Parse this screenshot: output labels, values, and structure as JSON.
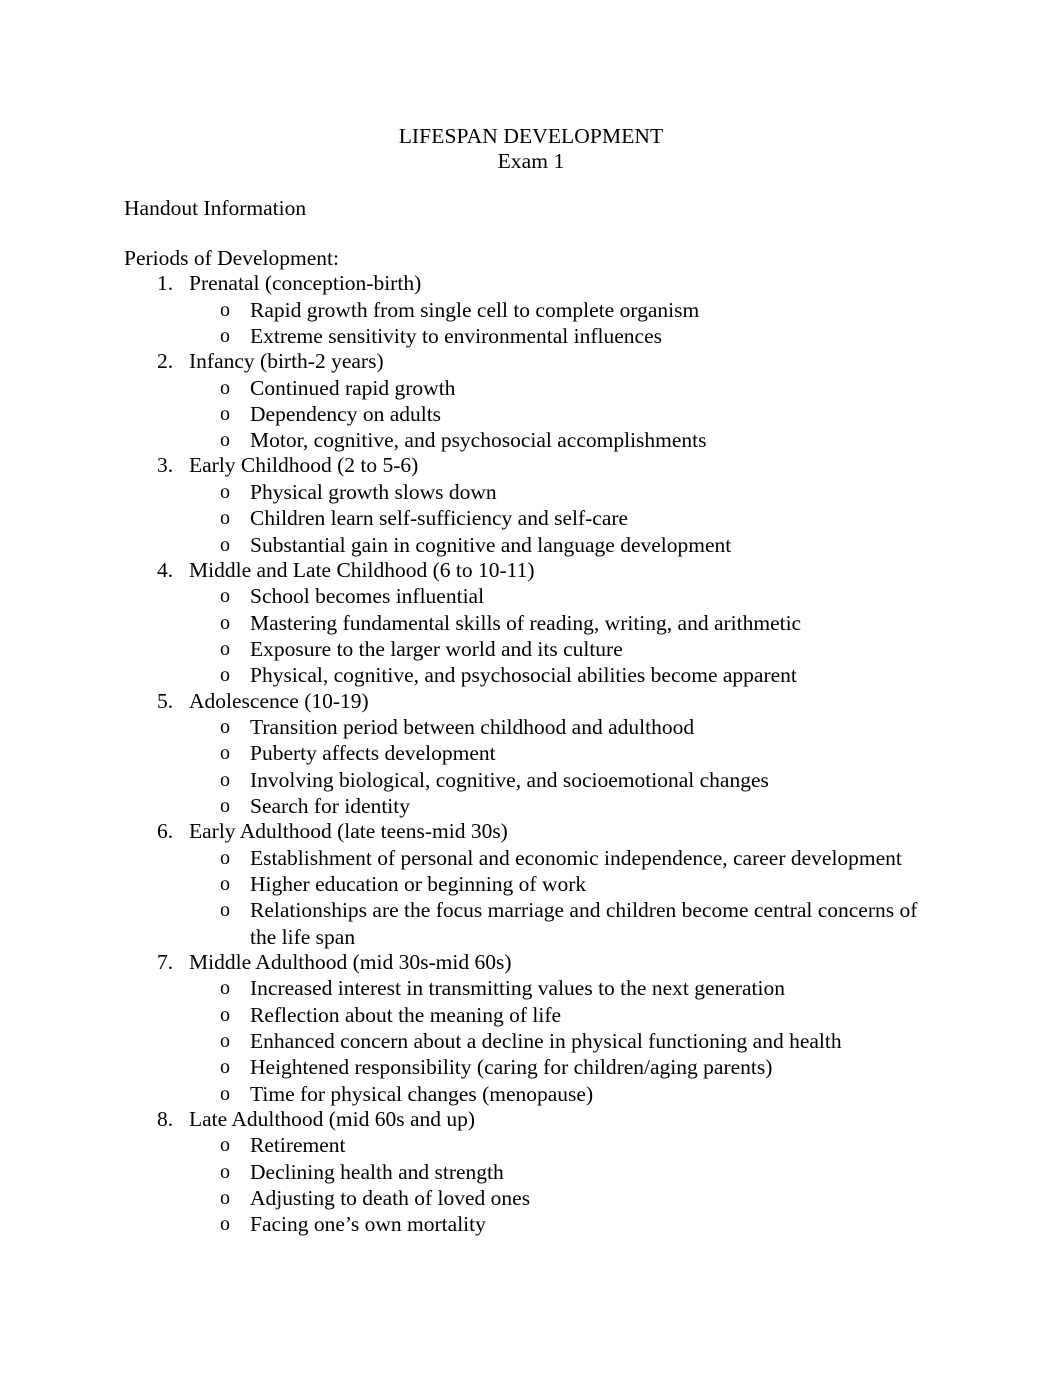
{
  "document": {
    "title": "LIFESPAN DEVELOPMENT",
    "subtitle": "Exam 1",
    "intro": "Handout Information",
    "section_heading": "Periods of Development:",
    "sub_bullet_marker": "o",
    "text_color": "#000000",
    "background_color": "#ffffff"
  },
  "periods": [
    {
      "number": "1.",
      "label": "Prenatal (conception-birth)",
      "points": [
        "Rapid growth from single cell to complete organism",
        "Extreme sensitivity to environmental influences"
      ]
    },
    {
      "number": "2.",
      "label": "Infancy (birth-2 years)",
      "points": [
        "Continued rapid growth",
        "Dependency on adults",
        "Motor, cognitive, and psychosocial accomplishments"
      ]
    },
    {
      "number": "3.",
      "label": "Early Childhood (2 to 5-6)",
      "points": [
        "Physical growth slows down",
        "Children learn self-sufficiency and self-care",
        "Substantial gain in cognitive and language development"
      ]
    },
    {
      "number": "4.",
      "label": "Middle and Late Childhood (6 to 10-11)",
      "points": [
        "School becomes influential",
        "Mastering fundamental skills of reading, writing, and arithmetic",
        "Exposure to the larger world and its culture",
        "Physical, cognitive, and psychosocial abilities become apparent"
      ]
    },
    {
      "number": "5.",
      "label": "Adolescence (10-19)",
      "points": [
        "Transition period between childhood and adulthood",
        "Puberty affects development",
        "Involving biological, cognitive, and socioemotional changes",
        "Search for identity"
      ]
    },
    {
      "number": "6.",
      "label": "Early Adulthood (late teens-mid 30s)",
      "points": [
        "Establishment of personal and economic independence, career development",
        "Higher education or beginning of work",
        "Relationships are the focus marriage and children become central concerns of the life span"
      ]
    },
    {
      "number": "7.",
      "label": "Middle Adulthood (mid 30s-mid 60s)",
      "points": [
        "Increased interest in transmitting values to the next generation",
        "Reflection about the meaning of life",
        "Enhanced concern about a decline in physical functioning and health",
        "Heightened responsibility (caring for children/aging parents)",
        "Time for physical changes (menopause)"
      ]
    },
    {
      "number": "8.",
      "label": "Late Adulthood (mid 60s and up)",
      "points": [
        "Retirement",
        "Declining health and strength",
        "Adjusting to death of loved ones",
        "Facing one’s own mortality"
      ]
    }
  ]
}
